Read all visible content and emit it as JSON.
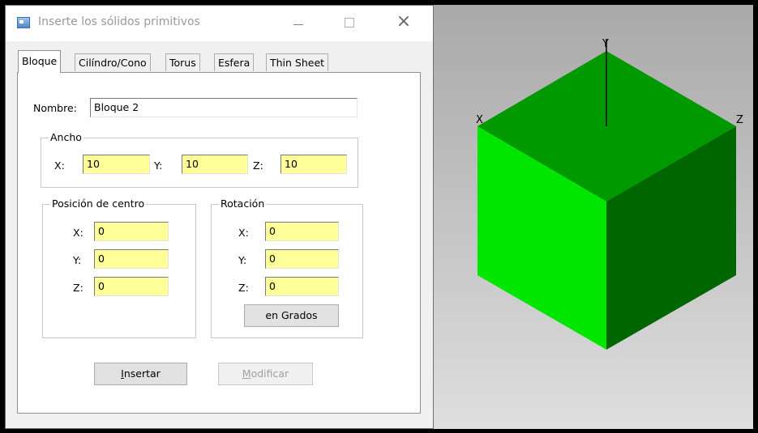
{
  "window": {
    "title": "Inserte los sólidos primitivos"
  },
  "tabs": [
    {
      "label": "Bloque",
      "active": true
    },
    {
      "label": "Cilíndro/Cono",
      "active": false
    },
    {
      "label": "Torus",
      "active": false
    },
    {
      "label": "Esfera",
      "active": false
    },
    {
      "label": "Thin Sheet",
      "active": false
    }
  ],
  "form": {
    "nombre_label": "Nombre:",
    "nombre_value": "Bloque 2",
    "ancho": {
      "title": "Ancho",
      "x_label": "X:",
      "x_value": "10",
      "y_label": "Y:",
      "y_value": "10",
      "z_label": "Z:",
      "z_value": "10"
    },
    "posicion": {
      "title": "Posición de centro",
      "x_label": "X:",
      "x_value": "0",
      "y_label": "Y:",
      "y_value": "0",
      "z_label": "Z:",
      "z_value": "0"
    },
    "rotacion": {
      "title": "Rotación",
      "x_label": "X:",
      "x_value": "0",
      "y_label": "Y:",
      "y_value": "0",
      "z_label": "Z:",
      "z_value": "0",
      "units_button": "en Grados"
    },
    "insertar_first": "I",
    "insertar_rest": "nsertar",
    "modificar_first": "M",
    "modificar_rest": "odificar"
  },
  "viewport": {
    "axis_x": "X",
    "axis_y": "Y",
    "axis_z": "Z",
    "colors": {
      "top": "#009900",
      "left": "#00e600",
      "right": "#006600",
      "background": "#c6c6c6"
    }
  },
  "colors": {
    "field_highlight": "#ffff99",
    "dialog_bg": "#f0f0f0"
  }
}
